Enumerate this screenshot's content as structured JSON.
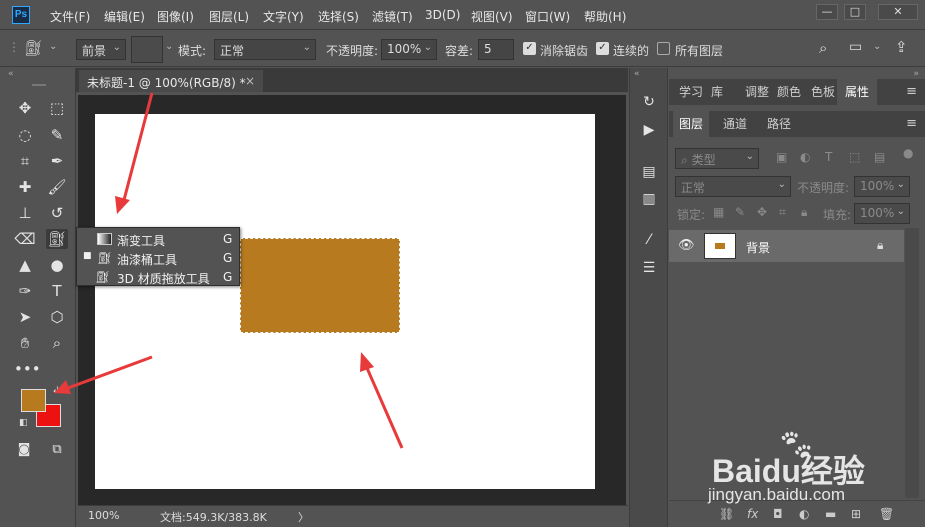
{
  "menubar": {
    "logo": "Ps",
    "items": [
      "文件(F)",
      "编辑(E)",
      "图像(I)",
      "图层(L)",
      "文字(Y)",
      "选择(S)",
      "滤镜(T)",
      "3D(D)",
      "视图(V)",
      "窗口(W)",
      "帮助(H)"
    ]
  },
  "options": {
    "fill_source": "前景",
    "mode_label": "模式:",
    "mode_value": "正常",
    "opacity_label": "不透明度:",
    "opacity_value": "100%",
    "tolerance_label": "容差:",
    "tolerance_value": "5",
    "antialias_label": "消除锯齿",
    "antialias_checked": true,
    "contiguous_label": "连续的",
    "contiguous_checked": true,
    "all_layers_label": "所有图层",
    "all_layers_checked": false
  },
  "document": {
    "tab_title": "未标题-1 @ 100%(RGB/8) *",
    "close": "×",
    "fill_color": "#b87a1f"
  },
  "flyout": {
    "items": [
      {
        "label": "渐变工具",
        "key": "G",
        "selected": false,
        "icon": "gradient-icon"
      },
      {
        "label": "油漆桶工具",
        "key": "G",
        "selected": true,
        "icon": "paint-bucket-icon"
      },
      {
        "label": "3D 材质拖放工具",
        "key": "G",
        "selected": false,
        "icon": "3d-material-drop-icon"
      }
    ]
  },
  "colors": {
    "foreground": "#b87a1f",
    "background": "#ee1111"
  },
  "status": {
    "zoom": "100%",
    "doc_info": "文档:549.3K/383.8K",
    "arrow": "〉"
  },
  "panels": {
    "top_tabs": [
      "学习",
      "库",
      "调整",
      "颜色",
      "色板",
      "属性"
    ],
    "active_top_tab": "属性",
    "layer_tabs": [
      "图层",
      "通道",
      "路径"
    ],
    "active_layer_tab": "图层",
    "filter_label": "类型",
    "blend_mode": "正常",
    "opacity_label": "不透明度:",
    "opacity_value": "100%",
    "lock_label": "锁定:",
    "fill_label": "填充:",
    "fill_value": "100%",
    "layer_name": "背景"
  },
  "watermark": {
    "brand": "Baidu经验",
    "url": "jingyan.baidu.com"
  }
}
